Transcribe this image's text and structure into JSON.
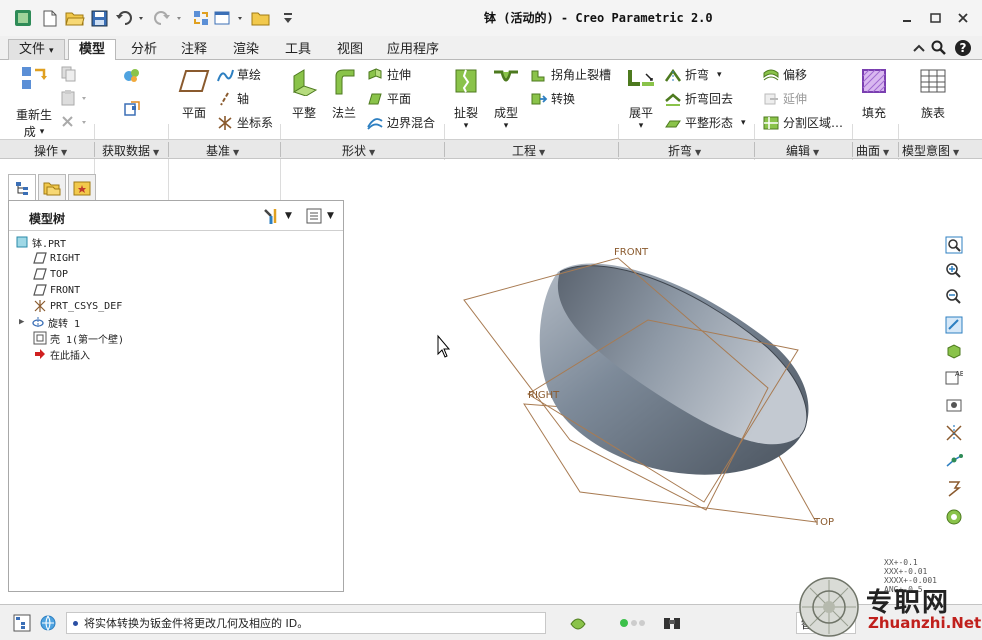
{
  "window": {
    "title": "钵 (活动的) - Creo Parametric 2.0",
    "controls": [
      "minimize-icon",
      "restore-icon",
      "close-icon"
    ]
  },
  "quick_access": [
    "app-logo-icon",
    "new-file-icon",
    "open-folder-icon",
    "save-icon",
    "undo-icon",
    "redo-icon",
    "regenerate-icon",
    "window-icon",
    "folder-icon",
    "customize-icon"
  ],
  "tabs": [
    {
      "label": "文件",
      "dropdown": "▾"
    },
    {
      "label": "模型",
      "active": true
    },
    {
      "label": "分析"
    },
    {
      "label": "注释"
    },
    {
      "label": "渲染"
    },
    {
      "label": "工具"
    },
    {
      "label": "视图"
    },
    {
      "label": "应用程序"
    }
  ],
  "ribbon": {
    "operations": {
      "regen_line1": "重新生",
      "regen_line2": "成",
      "dropdown": "▾"
    },
    "datum": {
      "plane": "平面",
      "sketch": "草绘",
      "axis": "轴",
      "csys": "坐标系"
    },
    "shape": {
      "flat": "平整",
      "flange": "法兰",
      "extrude": "拉伸",
      "planar": "平面",
      "boundary_blend": "边界混合"
    },
    "engineering": {
      "rip": "扯裂",
      "form": "成型",
      "corner_relief": "拐角止裂槽",
      "convert": "转换",
      "dropdown": "▾"
    },
    "bends": {
      "unbend": "展平",
      "bend": "折弯",
      "bend_back": "折弯回去",
      "flat_pattern": "平整形态",
      "dropdown": "▾"
    },
    "editing": {
      "offset": "偏移",
      "extend": "延伸",
      "split_area": "分割区域…"
    },
    "surfaces": {
      "fill": "填充"
    },
    "model_intent": {
      "family_table": "族表"
    }
  },
  "groups": [
    {
      "label": "操作"
    },
    {
      "label": "获取数据"
    },
    {
      "label": "基准"
    },
    {
      "label": "形状"
    },
    {
      "label": "工程"
    },
    {
      "label": "折弯"
    },
    {
      "label": "编辑"
    },
    {
      "label": "曲面"
    },
    {
      "label": "模型意图"
    }
  ],
  "model_tree": {
    "title": "模型树",
    "items": [
      {
        "label": "钵.PRT",
        "icon": "part-icon"
      },
      {
        "label": "RIGHT",
        "icon": "datum-plane-icon"
      },
      {
        "label": "TOP",
        "icon": "datum-plane-icon"
      },
      {
        "label": "FRONT",
        "icon": "datum-plane-icon"
      },
      {
        "label": "PRT_CSYS_DEF",
        "icon": "csys-icon"
      },
      {
        "label": "旋转 1",
        "icon": "revolve-icon"
      },
      {
        "label": "壳 1(第一个壁)",
        "icon": "shell-icon"
      },
      {
        "label": "在此插入",
        "icon": "insert-here-icon"
      }
    ]
  },
  "graphics": {
    "datum_labels": {
      "front": "FRONT",
      "right": "RIGHT",
      "top": "TOP"
    },
    "readout": [
      "XX+-0.1",
      "XXX+-0.01",
      "XXXX+-0.001",
      "ANG+-0.5"
    ],
    "colors": {
      "datum": "#8a5a2e",
      "body": "#7d8a99",
      "viewtool": "#2d7fc1"
    }
  },
  "status": {
    "message": "将实体转换为钣金件将更改几何及相应的 ID。",
    "filter_label": "智能"
  },
  "watermark": {
    "brand": "专职网",
    "url": "Zhuanzhi.Net"
  }
}
